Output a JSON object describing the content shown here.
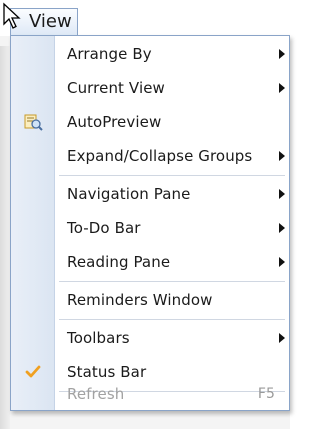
{
  "menubar": {
    "view_label": "View"
  },
  "menu": {
    "items": [
      {
        "label": "Arrange By",
        "submenu": true
      },
      {
        "label": "Current View",
        "submenu": true
      },
      {
        "label": "AutoPreview",
        "submenu": false,
        "icon": "autopreview-icon"
      },
      {
        "label": "Expand/Collapse Groups",
        "submenu": true
      },
      {
        "label": "Navigation Pane",
        "submenu": true
      },
      {
        "label": "To-Do Bar",
        "submenu": true
      },
      {
        "label": "Reading Pane",
        "submenu": true
      },
      {
        "label": "Reminders Window",
        "submenu": false
      },
      {
        "label": "Toolbars",
        "submenu": true
      },
      {
        "label": "Status Bar",
        "submenu": false,
        "checked": true,
        "icon": "checkmark-icon"
      },
      {
        "label": "Refresh",
        "submenu": false,
        "disabled": true,
        "shortcut": "F5"
      }
    ]
  },
  "colors": {
    "accent_border": "#8aa4c8",
    "gutter": "#dbe5f2",
    "check": "#f0a020"
  }
}
